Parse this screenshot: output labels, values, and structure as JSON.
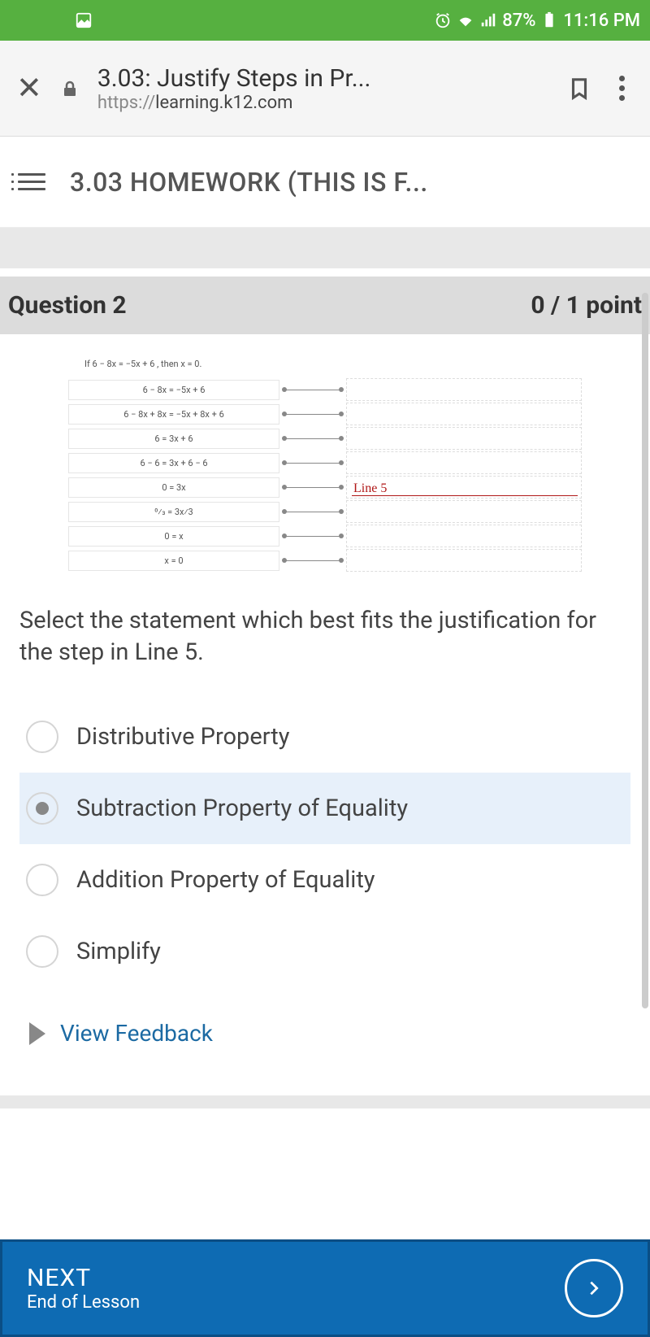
{
  "status": {
    "battery": "87%",
    "time": "11:16 PM"
  },
  "browser": {
    "title": "3.03: Justify Steps in Pr...",
    "url_prefix": "https://",
    "url_domain": "learning.k12.com"
  },
  "app": {
    "title": "3.03 HOMEWORK (THIS IS F..."
  },
  "question": {
    "label": "Question 2",
    "score": "0 / 1 point",
    "premise": "If 6 − 8x = −5x + 6 , then x = 0.",
    "steps": [
      "6 − 8x = −5x + 6",
      "6 − 8x + 8x = −5x + 8x + 6",
      "6 = 3x + 6",
      "6 − 6 = 3x + 6 − 6",
      "0 = 3x",
      "0⁄3 = 3x⁄3",
      "0 = x",
      "x = 0"
    ],
    "highlight_label": "Line 5",
    "prompt": "Select the statement which best fits the justification for the step in Line 5.",
    "options": [
      {
        "label": "Distributive Property",
        "selected": false
      },
      {
        "label": "Subtraction Property of Equality",
        "selected": true
      },
      {
        "label": "Addition Property of Equality",
        "selected": false
      },
      {
        "label": "Simplify",
        "selected": false
      }
    ],
    "feedback_toggle": "View Feedback"
  },
  "footer": {
    "next": "NEXT",
    "subtitle": "End of Lesson"
  }
}
